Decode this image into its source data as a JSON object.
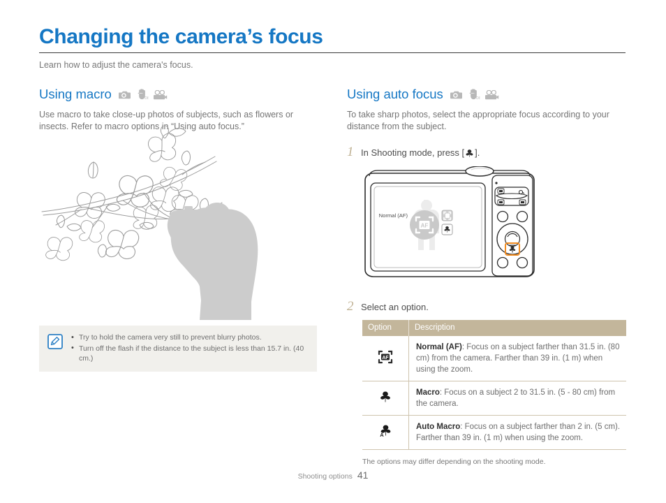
{
  "document": {
    "title": "Changing the camera’s focus",
    "subtitle": "Learn how to adjust the camera's focus."
  },
  "colors": {
    "title_blue": "#1577c4",
    "table_header": "#c3b69b",
    "note_background": "#f1f0ec",
    "step_number": "#c0b294",
    "highlight_orange": "#f08a1e",
    "body_text": "#747474"
  },
  "left_column": {
    "section_title": "Using macro",
    "mode_icons": [
      "camera-program-icon",
      "hand-dis-icon",
      "movie-icon"
    ],
    "body": "Use macro to take close-up photos of subjects, such as flowers or insects. Refer to macro options in “Using auto focus.”",
    "illustration": "magnolia-branch-with-photographer-silhouette",
    "note": {
      "icon": "note-pencil-icon",
      "items": [
        "Try to hold the camera very still to prevent blurry photos.",
        "Turn off the flash if the distance to the subject is less than 15.7 in. (40 cm.)"
      ]
    }
  },
  "right_column": {
    "section_title": "Using auto focus",
    "mode_icons": [
      "camera-program-icon",
      "hand-dis-icon",
      "movie-icon"
    ],
    "body": "To take sharp photos, select the appropriate focus according to your distance from the subject.",
    "steps": [
      {
        "number": "1",
        "text_before": "In Shooting mode, press [",
        "key_icon": "macro-flower-icon",
        "text_after": "]."
      },
      {
        "number": "2",
        "text_before": "Select an option.",
        "key_icon": "",
        "text_after": ""
      }
    ],
    "camera_illustration": {
      "lcd_label": "Normal (AF)",
      "lcd_main_icon": "af-bracket-icon",
      "lcd_option_icons": [
        "af-bracket-icon",
        "macro-flower-icon"
      ],
      "highlighted_button": "macro-button"
    },
    "table": {
      "headers": [
        "Option",
        "Description"
      ],
      "rows": [
        {
          "icon": "af-bracket-icon",
          "bold": "Normal (AF)",
          "description": ": Focus on a subject farther than 31.5 in. (80 cm) from the camera. Farther than 39 in. (1 m) when using the zoom."
        },
        {
          "icon": "macro-flower-icon",
          "bold": "Macro",
          "description": ": Focus on a subject 2 to 31.5 in. (5 - 80 cm) from the camera."
        },
        {
          "icon": "auto-macro-flower-icon",
          "bold": "Auto Macro",
          "description": ": Focus on a subject farther than 2 in. (5 cm). Farther than 39 in. (1 m) when using the zoom."
        }
      ],
      "footnote": "The options may differ depending on the shooting mode."
    }
  },
  "footer": {
    "label": "Shooting options",
    "page_number": "41"
  }
}
